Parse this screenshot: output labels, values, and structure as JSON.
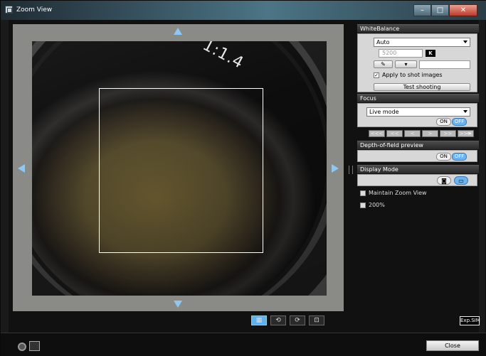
{
  "window": {
    "title": "Zoom View",
    "minimize": "–",
    "maximize": "□",
    "close": "✕"
  },
  "viewer": {
    "lens_text": "1:1.4",
    "arrows": {
      "up": "arrow-up",
      "down": "arrow-down",
      "left": "arrow-left",
      "right": "arrow-right"
    },
    "toolbar": [
      "zoom-icon",
      "rotate-left-icon",
      "rotate-right-icon",
      "fit-icon"
    ]
  },
  "panel": {
    "white_balance": {
      "header": "WhiteBalance",
      "mode": "Auto",
      "kelvin": "5200",
      "kelvin_badge": "K",
      "apply_label": "Apply to shot images",
      "apply_checked": true,
      "test_button": "Test shooting"
    },
    "focus": {
      "header": "Focus",
      "mode": "Live mode",
      "on": "ON",
      "off": "OFF",
      "steps": [
        "<<<",
        "<<",
        "<",
        ">",
        ">>",
        ">>>"
      ],
      "infinity": "∞"
    },
    "dof": {
      "header": "Depth-of-field preview",
      "on": "ON",
      "off": "OFF"
    },
    "display_mode": {
      "header": "Display Mode"
    },
    "options": [
      {
        "label": "Maintain Zoom View",
        "checked": false
      },
      {
        "label": "200%",
        "checked": false
      }
    ],
    "exp_sim": "Exp.SIM"
  },
  "footer": {
    "close_button": "Close"
  },
  "colors": {
    "accent": "#6bb4ef",
    "arrow": "#8fc7f3"
  }
}
